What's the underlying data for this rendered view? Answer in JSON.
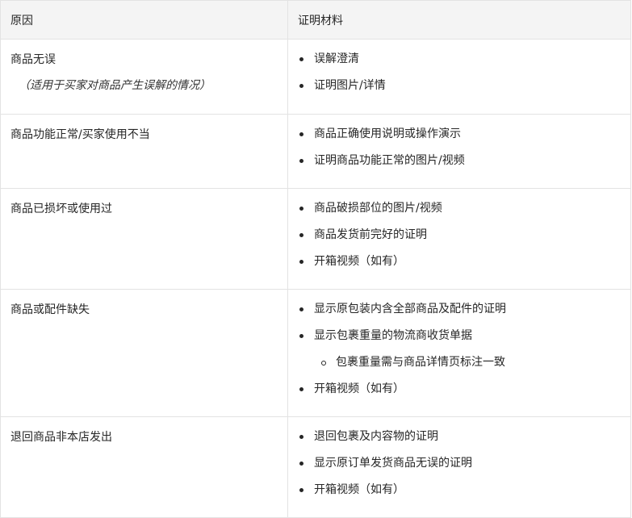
{
  "header": {
    "col_reason": "原因",
    "col_evidence": "证明材料"
  },
  "rows": [
    {
      "reason": "商品无误",
      "note": "（适用于买家对商品产生误解的情况）",
      "evidence": [
        "误解澄清",
        "证明图片/详情"
      ]
    },
    {
      "reason": "商品功能正常/买家使用不当",
      "evidence": [
        "商品正确使用说明或操作演示",
        "证明商品功能正常的图片/视频"
      ]
    },
    {
      "reason": "商品已损坏或使用过",
      "evidence": [
        "商品破损部位的图片/视频",
        "商品发货前完好的证明",
        "开箱视频（如有）"
      ]
    },
    {
      "reason": "商品或配件缺失",
      "evidence": [
        "显示原包装内含全部商品及配件的证明",
        "显示包裹重量的物流商收货单据",
        "包裹重量需与商品详情页标注一致",
        "开箱视频（如有）"
      ]
    },
    {
      "reason": "退回商品非本店发出",
      "evidence": [
        "退回包裹及内容物的证明",
        "显示原订单发货商品无误的证明",
        "开箱视频（如有）"
      ]
    }
  ]
}
